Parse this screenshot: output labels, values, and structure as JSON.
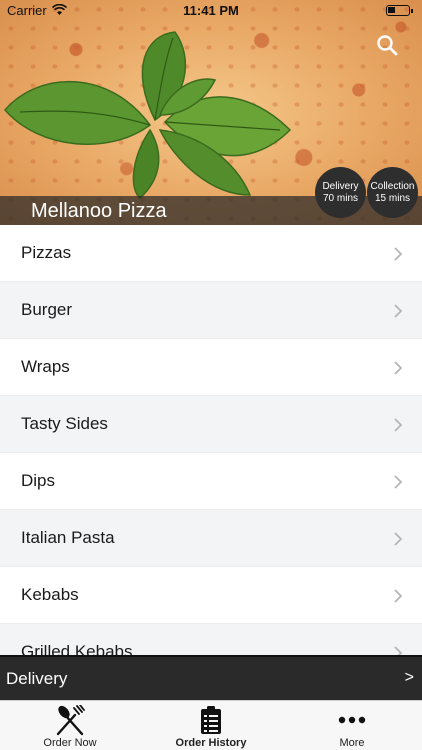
{
  "status_bar": {
    "carrier": "Carrier",
    "time": "11:41 PM"
  },
  "header": {
    "restaurant_name": "Mellanoo Pizza",
    "delivery_badge": {
      "label": "Delivery",
      "time": "70 mins"
    },
    "collection_badge": {
      "label": "Collection",
      "time": "15 mins"
    }
  },
  "menu": {
    "categories": [
      {
        "label": "Pizzas"
      },
      {
        "label": "Burger"
      },
      {
        "label": "Wraps"
      },
      {
        "label": "Tasty Sides"
      },
      {
        "label": "Dips"
      },
      {
        "label": "Italian Pasta"
      },
      {
        "label": "Kebabs"
      },
      {
        "label": "Grilled Kebabs"
      }
    ]
  },
  "delivery_bar": {
    "label": "Delivery",
    "arrow": ">"
  },
  "tab_bar": {
    "tabs": [
      {
        "label": "Order Now",
        "icon": "fork-knife-icon"
      },
      {
        "label": "Order History",
        "icon": "clipboard-list-icon"
      },
      {
        "label": "More",
        "icon": "more-dots-icon"
      }
    ]
  },
  "colors": {
    "dark_bar": "#2a2a2a",
    "alt_row": "#f3f4f6",
    "badge_bg": "#2e2e2e"
  }
}
